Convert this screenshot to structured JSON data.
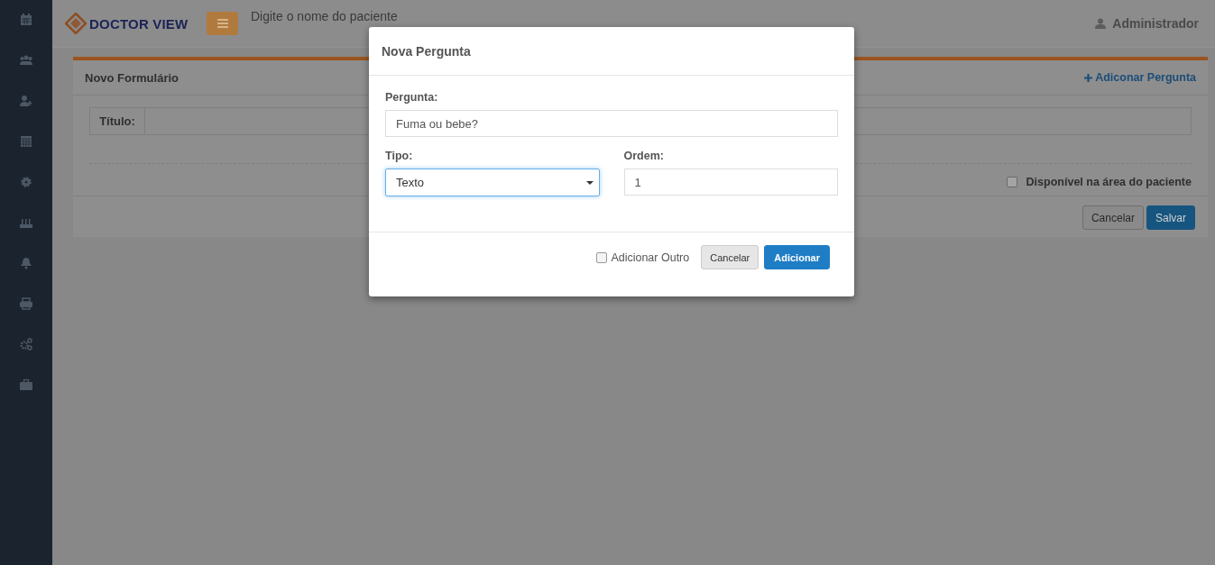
{
  "header": {
    "logo_text": "DOCTOR VIEW",
    "search": {
      "placeholder": "Digite o nome do paciente"
    },
    "user": "Administrador"
  },
  "form": {
    "title": "Novo Formulário",
    "add_link": "Adiconar Pergunta",
    "title_label": "Título:",
    "available": {
      "label": "Disponível na área do paciente",
      "checked": false
    },
    "buttons": [
      "Cancelar",
      "Salvar"
    ]
  },
  "modal": {
    "title": "Nova Pergunta",
    "question_label": "Pergunta:",
    "question_value": "Fuma ou bebe?",
    "type_label": "Tipo:",
    "type_value": "Texto",
    "order_label": "Ordem:",
    "order_value": "1",
    "add_other": {
      "label": "Adicionar Outro",
      "checked": false
    },
    "buttons": [
      "Cancelar",
      "Adicionar"
    ]
  }
}
